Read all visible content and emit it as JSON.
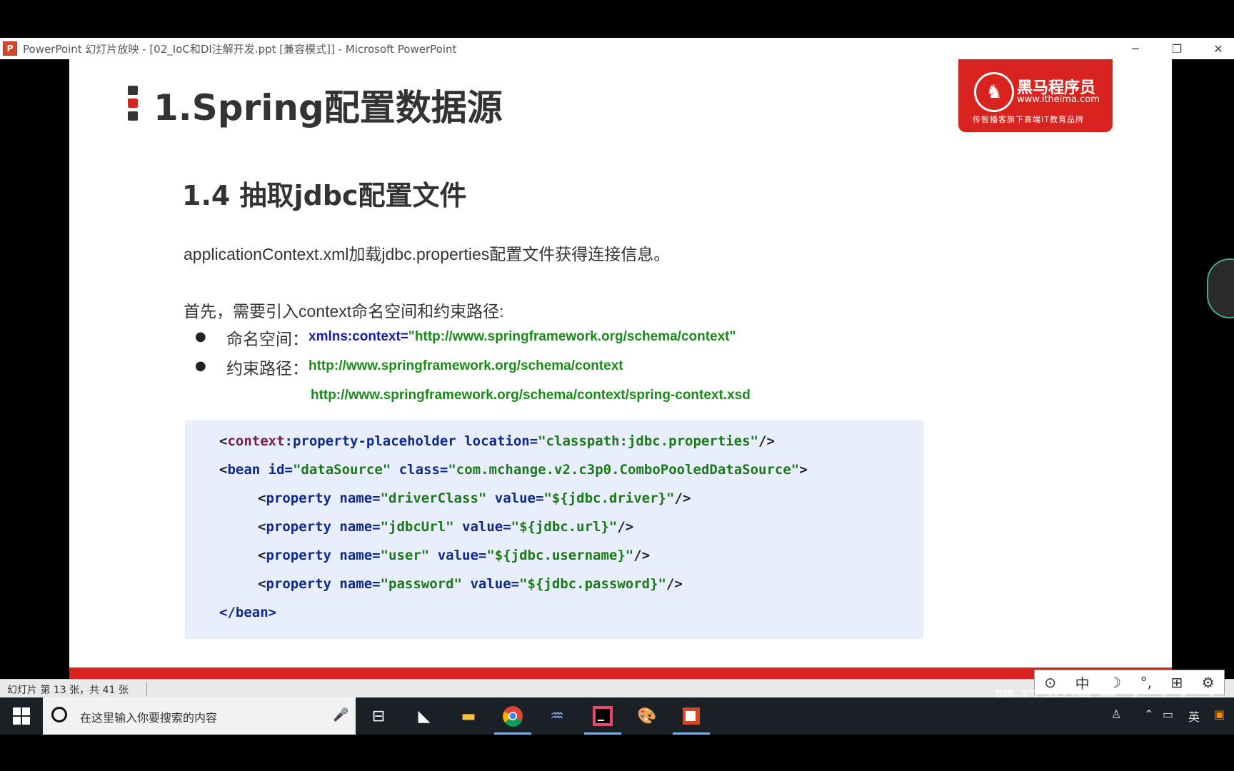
{
  "window": {
    "app_icon": "P",
    "title": "PowerPoint 幻灯片放映 - [02_IoC和DI注解开发.ppt [兼容模式]] - Microsoft PowerPoint",
    "minimize_icon": "─",
    "restore_icon": "❐",
    "close_icon": "✕"
  },
  "slide": {
    "title": "1.Spring配置数据源",
    "logo": {
      "name": "黑马程序员",
      "url": "www.itheima.com",
      "tagline": "传智播客旗下高端IT教育品牌"
    },
    "subtitle": "1.4 抽取jdbc配置文件",
    "intro": "applicationContext.xml加载jdbc.properties配置文件获得连接信息。",
    "first": "首先，需要引入context命名空间和约束路径:",
    "bullets": [
      {
        "label": "命名空间：",
        "kw": "xmlns:context=",
        "value": "\"http://www.springframework.org/schema/context\""
      },
      {
        "label": "约束路径：",
        "value": "http://www.springframework.org/schema/context"
      }
    ],
    "bullet_line2": "http://www.springframework.org/schema/context/spring-context.xsd",
    "code": {
      "l1": {
        "lt": "<",
        "ns": "context",
        "tag": ":property-placeholder",
        "attr": " location=",
        "val": "\"classpath:jdbc.properties\"",
        "end": "/>"
      },
      "l2": {
        "lt": "<",
        "tag": "bean",
        "a1": " id=",
        "v1": "\"dataSource\"",
        "a2": " class=",
        "v2": "\"com.mchange.v2.c3p0.ComboPooledDataSource\"",
        "end": ">"
      },
      "props": [
        {
          "name": "\"driverClass\"",
          "value": "\"${jdbc.driver}\""
        },
        {
          "name": "\"jdbcUrl\"",
          "value": "\"${jdbc.url}\""
        },
        {
          "name": "\"user\"",
          "value": "\"${jdbc.username}\""
        },
        {
          "name": "\"password\"",
          "value": "\"${jdbc.password}\""
        }
      ],
      "prop_tag": "property",
      "name_attr": " name=",
      "value_attr": " value=",
      "close": "</bean>"
    }
  },
  "status": {
    "slide_info": "幻灯片 第 13 张，共 41 张"
  },
  "ime": {
    "items": [
      "⊙",
      "中",
      "☽",
      "°,",
      "⊞",
      "⚙"
    ]
  },
  "taskbar": {
    "search_placeholder": "在这里输入你要搜索的内容",
    "mic_icon": "🎤",
    "tray": {
      "lang": "英"
    }
  },
  "watermark": "黑马程序员 bilibili"
}
